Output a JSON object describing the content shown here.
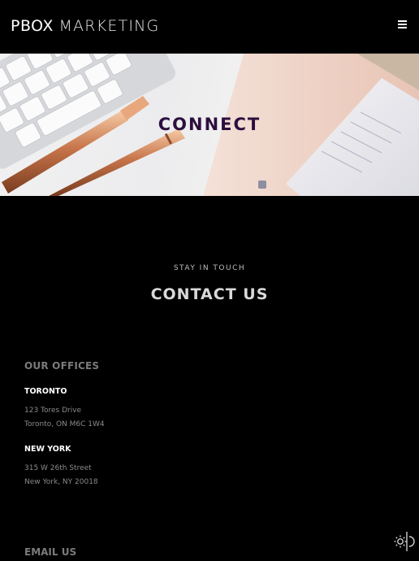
{
  "header": {
    "logo_bold": "PBOX",
    "logo_light": "MARKETING",
    "menu_icon": "hamburger-icon"
  },
  "hero": {
    "title": "CONNECT"
  },
  "contact": {
    "kicker": "STAY IN TOUCH",
    "title": "CONTACT US",
    "offices_heading": "OUR OFFICES",
    "offices": [
      {
        "name": "TORONTO",
        "line1": "123 Tores Drive",
        "line2": "Toronto, ON M6C 1W4"
      },
      {
        "name": "NEW YORK",
        "line1": "315 W 26th Street",
        "line2": "New York, NY 20018"
      }
    ],
    "email_heading": "EMAIL US"
  },
  "theme_toggle_icon": "sun-moon-icon",
  "colors": {
    "background": "#000000",
    "hero_title": "#2c0f3f",
    "muted_heading": "#7b7b7b",
    "address_text": "#8a8a8a"
  }
}
